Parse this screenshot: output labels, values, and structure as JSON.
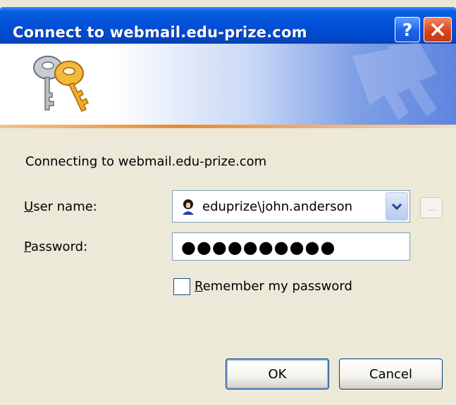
{
  "window": {
    "title": "Connect to webmail.edu-prize.com",
    "help_label": "?"
  },
  "body": {
    "connecting_text": "Connecting to webmail.edu-prize.com"
  },
  "fields": {
    "username_label_access": "U",
    "username_label_rest": "ser name:",
    "username_value": "eduprize\\john.anderson",
    "password_label_access": "P",
    "password_label_rest": "assword:",
    "password_masked": "●●●●●●●●●●"
  },
  "remember": {
    "label_access": "R",
    "label_rest": "emember my password",
    "checked": false
  },
  "buttons": {
    "ok": "OK",
    "cancel": "Cancel",
    "browse": "..."
  },
  "colors": {
    "titlebar": "#0250d8",
    "dialog_bg": "#ece9d8",
    "close_red": "#d8451f",
    "banner_accent": "#e88a30"
  },
  "icons": {
    "header": "keys-icon",
    "user": "user-icon",
    "dropdown": "chevron-down-icon",
    "close": "close-icon",
    "help": "help-icon"
  }
}
